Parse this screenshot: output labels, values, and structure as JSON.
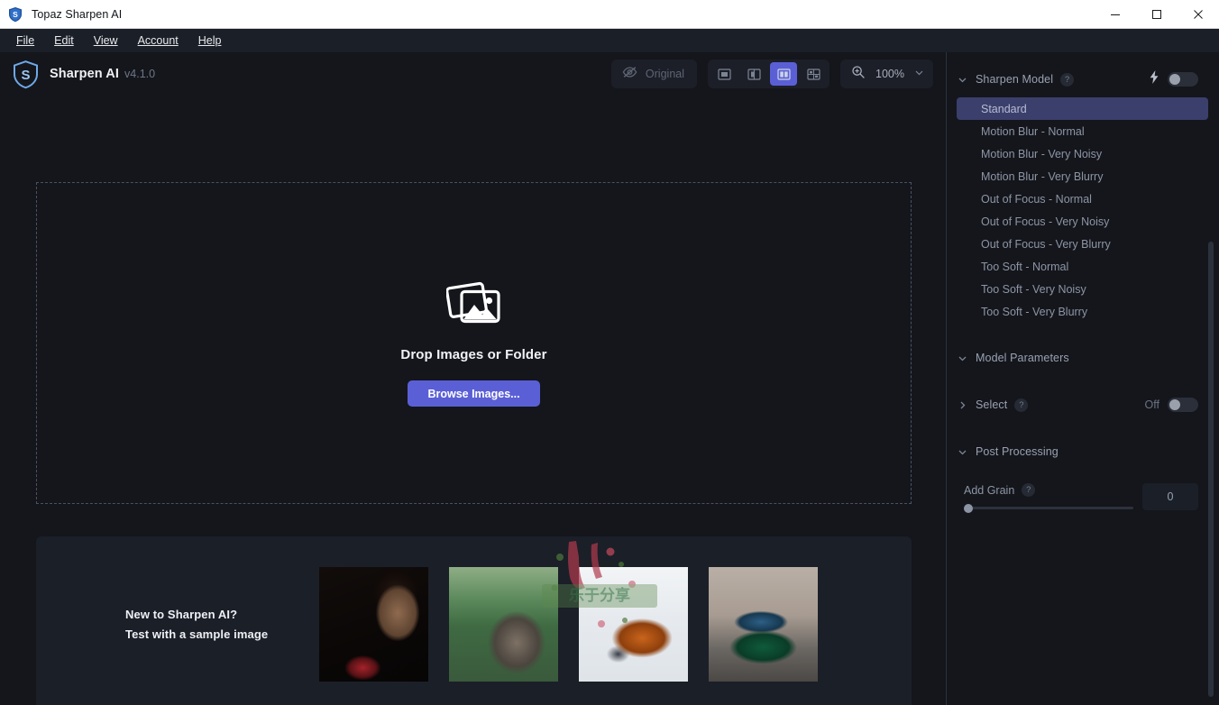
{
  "window": {
    "title": "Topaz Sharpen AI",
    "app_icon": "shield-s-icon",
    "controls": {
      "minimize": "minimize-icon",
      "maximize": "maximize-icon",
      "close": "close-icon"
    }
  },
  "menubar": {
    "items": [
      {
        "label": "File",
        "accel": "F"
      },
      {
        "label": "Edit",
        "accel": "E"
      },
      {
        "label": "View",
        "accel": "V"
      },
      {
        "label": "Account",
        "accel": "A"
      },
      {
        "label": "Help",
        "accel": "H"
      }
    ]
  },
  "brand": {
    "name": "Sharpen AI",
    "version": "v4.1.0",
    "logo": "shield-s-icon"
  },
  "toolbar": {
    "original": {
      "label": "Original",
      "icon": "eye-off-icon",
      "enabled": false
    },
    "view_modes": [
      {
        "name": "single-view",
        "icon": "single-pane-icon",
        "active": false
      },
      {
        "name": "split-view",
        "icon": "split-pane-icon",
        "active": false
      },
      {
        "name": "side-by-side-view",
        "icon": "dual-pane-icon",
        "active": true
      },
      {
        "name": "grid-view",
        "icon": "grid-pane-icon",
        "active": false
      }
    ],
    "zoom": {
      "icon": "zoom-in-icon",
      "level": "100%",
      "chevron": "chevron-down-icon"
    }
  },
  "dropzone": {
    "icon": "images-stack-icon",
    "title": "Drop Images or Folder",
    "button_label": "Browse Images..."
  },
  "samples": {
    "heading_line1": "New to Sharpen AI?",
    "heading_line2": "Test with a sample image",
    "thumbnails": [
      {
        "name": "sample-thumb-woman",
        "alt": "woman-playing-instrument"
      },
      {
        "name": "sample-thumb-owl",
        "alt": "great-horned-owl"
      },
      {
        "name": "sample-thumb-fox",
        "alt": "red-fox-in-snow"
      },
      {
        "name": "sample-thumb-car",
        "alt": "green-classic-car"
      }
    ],
    "watermark_text": "乐于分享"
  },
  "right_panel": {
    "sharpen_model": {
      "title": "Sharpen Model",
      "help": "?",
      "chevron": "chevron-down-icon",
      "auto_icon": "lightning-bolt-icon",
      "toggle_on": false,
      "options": [
        {
          "label": "Standard",
          "selected": true
        },
        {
          "label": "Motion Blur - Normal",
          "selected": false
        },
        {
          "label": "Motion Blur - Very Noisy",
          "selected": false
        },
        {
          "label": "Motion Blur - Very Blurry",
          "selected": false
        },
        {
          "label": "Out of Focus - Normal",
          "selected": false
        },
        {
          "label": "Out of Focus - Very Noisy",
          "selected": false
        },
        {
          "label": "Out of Focus - Very Blurry",
          "selected": false
        },
        {
          "label": "Too Soft - Normal",
          "selected": false
        },
        {
          "label": "Too Soft - Very Noisy",
          "selected": false
        },
        {
          "label": "Too Soft - Very Blurry",
          "selected": false
        }
      ]
    },
    "model_parameters": {
      "title": "Model Parameters",
      "chevron": "chevron-down-icon"
    },
    "select": {
      "title": "Select",
      "help": "?",
      "chevron": "chevron-right-icon",
      "state_label": "Off",
      "toggle_on": false
    },
    "post_processing": {
      "title": "Post Processing",
      "chevron": "chevron-down-icon"
    },
    "add_grain": {
      "label": "Add Grain",
      "help": "?",
      "value": "0",
      "slider_percent": 0
    }
  },
  "colors": {
    "accent": "#5b5fd6",
    "selection": "#3b3f6b",
    "panel_bg": "#14161c",
    "surface": "#1b1f28",
    "text_primary": "#eef0f4",
    "text_muted": "#8d95a4",
    "titlebar_bg": "#ffffff"
  }
}
